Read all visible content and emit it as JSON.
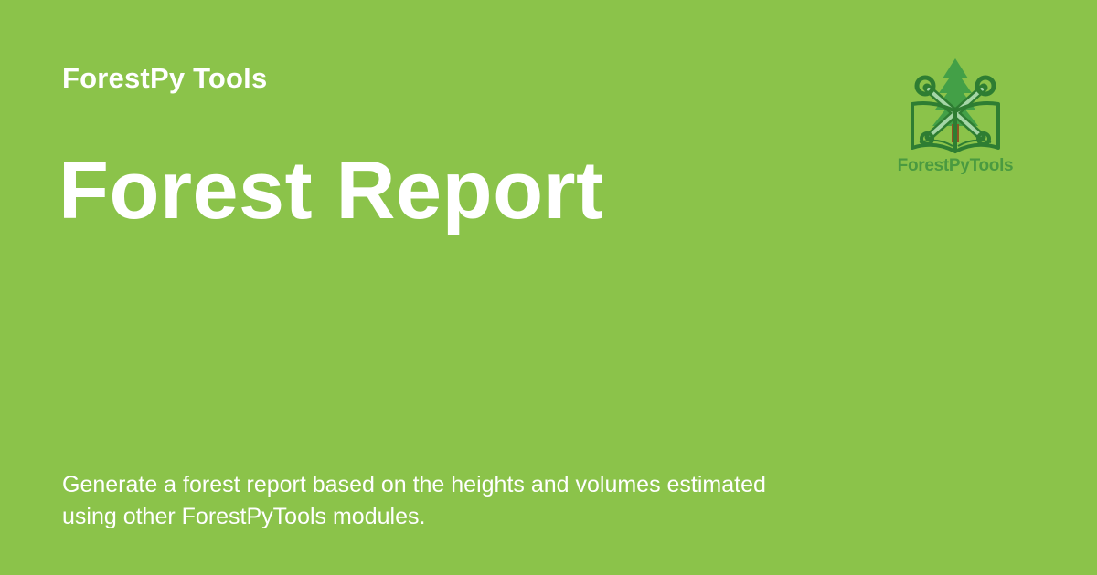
{
  "site": {
    "name": "ForestPy Tools"
  },
  "page": {
    "title": "Forest Report",
    "description": "Generate a forest report based on the heights and volumes estimated using other ForestPyTools modules."
  },
  "logo": {
    "text": "ForestPyTools",
    "icon": "tree-wrenches-book-icon"
  },
  "colors": {
    "background": "#8bc34a",
    "text": "#ffffff",
    "logo_green": "#4a9a40",
    "trunk_brown": "#8d5524"
  }
}
